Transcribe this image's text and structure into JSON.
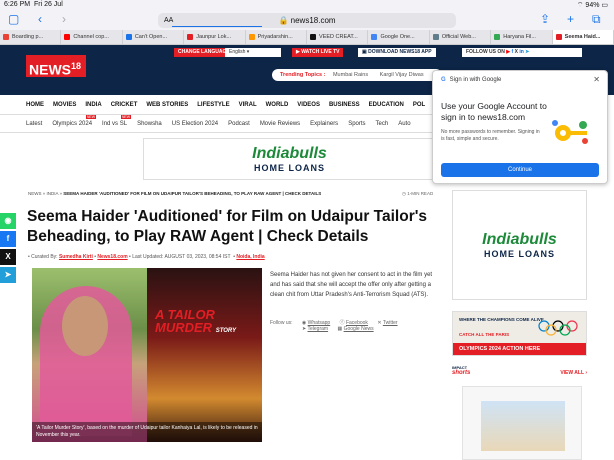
{
  "status": {
    "time": "6:26 PM",
    "date": "Fri 26 Jul",
    "battery": "94%"
  },
  "browser": {
    "aa": "AA",
    "url": "news18.com"
  },
  "tabs": [
    {
      "label": "Boarding p...",
      "color": "#ea4335"
    },
    {
      "label": "Channel cop...",
      "color": "#ff0000"
    },
    {
      "label": "Can't Open...",
      "color": "#1a73e8"
    },
    {
      "label": "Jaunpur Lok...",
      "color": "#e31e24"
    },
    {
      "label": "Priyadarshin...",
      "color": "#ff9800"
    },
    {
      "label": "VEED CREAT...",
      "color": "#111111"
    },
    {
      "label": "Google One...",
      "color": "#4285f4"
    },
    {
      "label": "Official Web...",
      "color": "#607d8b"
    },
    {
      "label": "Haryana Fil...",
      "color": "#34a853"
    },
    {
      "label": "Seema Haid...",
      "color": "#e31e24",
      "active": true
    }
  ],
  "header": {
    "logo": "NEWS",
    "logo_num": "18",
    "change_language": "CHANGE LANGUAGE",
    "language": "English",
    "watch_live": "WATCH LIVE TV",
    "download_app": "DOWNLOAD NEWS18 APP",
    "follow_us": "FOLLOW US ON",
    "trending_label": "Trending Topics :",
    "trending": [
      "Mumbai Rains",
      "Kargil Vijay Diwas"
    ]
  },
  "menu": [
    "HOME",
    "MOVIES",
    "INDIA",
    "CRICKET",
    "WEB STORIES",
    "LIFESTYLE",
    "VIRAL",
    "WORLD",
    "VIDEOS",
    "BUSINESS",
    "EDUCATION",
    "POL"
  ],
  "submenu": [
    "Latest",
    "Olympics 2024",
    "Ind vs SL",
    "Showsha",
    "US Election 2024",
    "Podcast",
    "Movie Reviews",
    "Explainers",
    "Sports",
    "Tech",
    "Auto"
  ],
  "ad": {
    "brand": "Indiabulls",
    "product": "HOME LOANS"
  },
  "article": {
    "breadcrumb": [
      "NEWS",
      "INDIA"
    ],
    "breadcrumb_current": "SEEMA HAIDER 'AUDITIONED' FOR FILM ON UDAIPUR TAILOR'S BEHEADING, TO PLAY RAW AGENT | CHECK DETAILS",
    "read_time": "1-MIN READ",
    "title": "Seema Haider 'Auditioned' for Film on Udaipur Tailor's Beheading, to Play RAW Agent | Check Details",
    "curated_label": "Curated By:",
    "author": "Sumedha Kirti",
    "source": "News18.com",
    "updated_label": "Last Updated:",
    "updated": "AUGUST 03, 2023, 08:54 IST",
    "location": "Noida, India",
    "body": "Seema Haider has not given her consent to act in the film yet and has said that she will accept the offer only after getting a clean chit from Uttar Pradesh's Anti-Terrorism Squad (ATS).",
    "follow_label": "Follow us:",
    "follow": [
      "Whatsapp",
      "Facebook",
      "Twitter",
      "Telegram",
      "Google News"
    ],
    "poster_line1": "A",
    "poster_line2": "TAILOR",
    "poster_line3": "MURDER",
    "poster_line4": "STORY",
    "caption": "'A Tailor Murder Story', based on the murder of Udaipur tailor Kanhaiya Lal, is likely to be released in November this year."
  },
  "google_popup": {
    "header": "Sign in with Google",
    "heading": "Use your Google Account to sign in to news18.com",
    "text": "No more passwords to remember. Signing in is fast, simple and secure.",
    "button": "Continue"
  },
  "sidebar": {
    "champ_title": "WHERE THE CHAMPIONS COME ALIVE",
    "champ_sub": "CATCH ALL THE PARIS",
    "champ_bar": "OLYMPICS 2024 ACTION HERE",
    "shorts_title": "shorts",
    "shorts_impact": "IMPACT",
    "view_all": "VIEW ALL ›"
  }
}
